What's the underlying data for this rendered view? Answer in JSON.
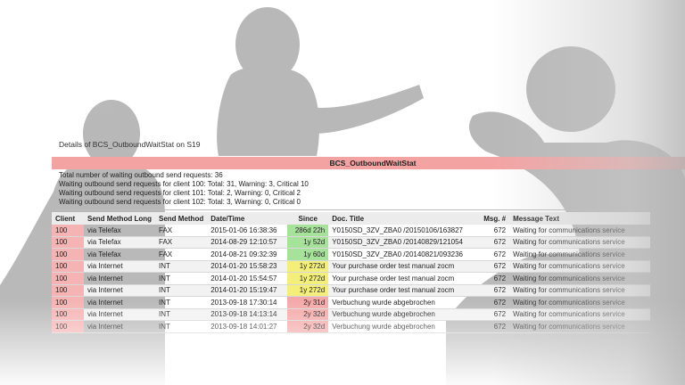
{
  "details_title": "Details of BCS_OutboundWaitStat on S19",
  "header": "BCS_OutboundWaitStat",
  "summary": [
    "Total number of waiting outbound send requests: 36",
    "Waiting outbound send requests for client 100: Total: 31, Warning: 3, Critical 10",
    "Waiting outbound send requests for client 101: Total: 2, Warning: 0, Critical 2",
    "Waiting outbound send requests for client 102: Total: 3, Warning: 0, Critical 0"
  ],
  "columns": [
    "Client",
    "Send Method Long",
    "Send Method",
    "Date/Time",
    "Since",
    "Doc. Title",
    "Msg. #",
    "Message Text"
  ],
  "rows": [
    {
      "client": "100",
      "long": "via Telefax",
      "method": "FAX",
      "date": "2015-01-06 16:38:36",
      "since": "286d 22h",
      "status": "green",
      "doc": "Y0150SD_3ZV_ZBA0 /20150106/163827",
      "msg": "672",
      "text": "Waiting for communications service"
    },
    {
      "client": "100",
      "long": "via Telefax",
      "method": "FAX",
      "date": "2014-08-29 12:10:57",
      "since": "1y 52d",
      "status": "green",
      "doc": "Y0150SD_3ZV_ZBA0 /20140829/121054",
      "msg": "672",
      "text": "Waiting for communications service"
    },
    {
      "client": "100",
      "long": "via Telefax",
      "method": "FAX",
      "date": "2014-08-21 09:32:39",
      "since": "1y 60d",
      "status": "green",
      "doc": "Y0150SD_3ZV_ZBA0 /20140821/093236",
      "msg": "672",
      "text": "Waiting for communications service"
    },
    {
      "client": "100",
      "long": "via Internet",
      "method": "INT",
      "date": "2014-01-20 15:58:23",
      "since": "1y 272d",
      "status": "yellow",
      "doc": "Your purchase order test manual zocm",
      "msg": "672",
      "text": "Waiting for communications service"
    },
    {
      "client": "100",
      "long": "via Internet",
      "method": "INT",
      "date": "2014-01-20 15:54:57",
      "since": "1y 272d",
      "status": "yellow",
      "doc": "Your purchase order test manual zocm",
      "msg": "672",
      "text": "Waiting for communications service"
    },
    {
      "client": "100",
      "long": "via Internet",
      "method": "INT",
      "date": "2014-01-20 15:19:47",
      "since": "1y 272d",
      "status": "yellow",
      "doc": "Your purchase order test manual zocm",
      "msg": "672",
      "text": "Waiting for communications service"
    },
    {
      "client": "100",
      "long": "via Internet",
      "method": "INT",
      "date": "2013-09-18 17:30:14",
      "since": "2y 31d",
      "status": "red",
      "doc": "Verbuchung wurde abgebrochen",
      "msg": "672",
      "text": "Waiting for communications service"
    },
    {
      "client": "100",
      "long": "via Internet",
      "method": "INT",
      "date": "2013-09-18 14:13:14",
      "since": "2y 32d",
      "status": "red",
      "doc": "Verbuchung wurde abgebrochen",
      "msg": "672",
      "text": "Waiting for communications service"
    },
    {
      "client": "100",
      "long": "via Internet",
      "method": "INT",
      "date": "2013-09-18 14:01:27",
      "since": "2y 32d",
      "status": "red",
      "doc": "Verbuchung wurde abgebrochen",
      "msg": "672",
      "text": "Waiting for communications service"
    }
  ],
  "colors": {
    "header": "#f4a3a3",
    "green": "#a6e29a",
    "yellow": "#f3ef7a",
    "red": "#f4a9a9",
    "silhouette": "#b5b5b5"
  }
}
